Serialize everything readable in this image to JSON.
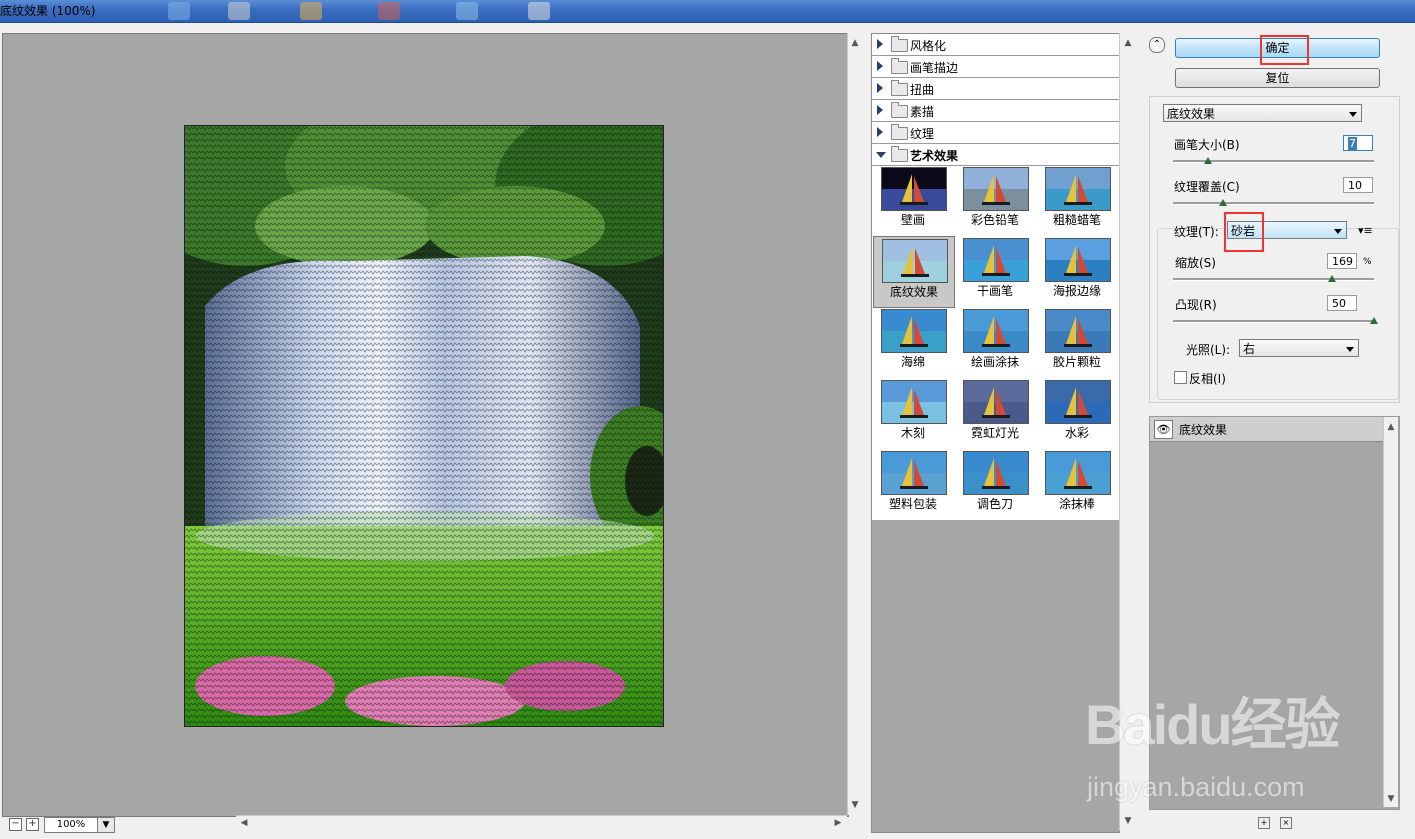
{
  "window": {
    "title": "底纹效果 (100%)"
  },
  "preview": {
    "zoom": "100%",
    "zoom_out": "−",
    "zoom_in": "+"
  },
  "gallery": {
    "categories": [
      {
        "label": "风格化",
        "open": false
      },
      {
        "label": "画笔描边",
        "open": false
      },
      {
        "label": "扭曲",
        "open": false
      },
      {
        "label": "素描",
        "open": false
      },
      {
        "label": "纹理",
        "open": false
      },
      {
        "label": "艺术效果",
        "open": true
      }
    ],
    "filters": [
      {
        "label": "壁画",
        "selected": false
      },
      {
        "label": "彩色铅笔",
        "selected": false
      },
      {
        "label": "粗糙蜡笔",
        "selected": false
      },
      {
        "label": "底纹效果",
        "selected": true
      },
      {
        "label": "干画笔",
        "selected": false
      },
      {
        "label": "海报边缘",
        "selected": false
      },
      {
        "label": "海绵",
        "selected": false
      },
      {
        "label": "绘画涂抹",
        "selected": false
      },
      {
        "label": "胶片颗粒",
        "selected": false
      },
      {
        "label": "木刻",
        "selected": false
      },
      {
        "label": "霓虹灯光",
        "selected": false
      },
      {
        "label": "水彩",
        "selected": false
      },
      {
        "label": "塑料包装",
        "selected": false
      },
      {
        "label": "调色刀",
        "selected": false
      },
      {
        "label": "涂抹棒",
        "selected": false
      }
    ]
  },
  "buttons": {
    "ok": "确定",
    "reset": "复位"
  },
  "settings": {
    "filter_select": "底纹效果",
    "brush_size": {
      "label": "画笔大小(B)",
      "value": "7",
      "max": 40
    },
    "texture_coverage": {
      "label": "纹理覆盖(C)",
      "value": "10",
      "max": 40
    },
    "texture": {
      "label": "纹理(T):",
      "value": "砂岩"
    },
    "scaling": {
      "label": "缩放(S)",
      "value": "169",
      "unit": "%",
      "min": 50,
      "max": 200
    },
    "relief": {
      "label": "凸现(R)",
      "value": "50",
      "max": 50
    },
    "light": {
      "label": "光照(L):",
      "value": "右"
    },
    "invert": {
      "label": "反相(I)",
      "checked": false
    }
  },
  "layers": [
    {
      "label": "底纹效果",
      "visible": true
    }
  ],
  "watermark": {
    "logo": "Baidu经验",
    "url": "jingyan.baidu.com"
  }
}
